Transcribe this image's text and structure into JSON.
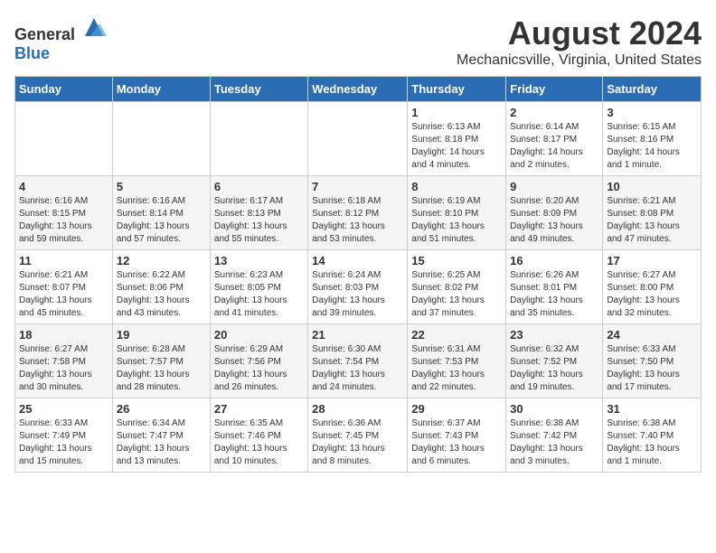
{
  "header": {
    "logo_general": "General",
    "logo_blue": "Blue",
    "title": "August 2024",
    "subtitle": "Mechanicsville, Virginia, United States"
  },
  "calendar": {
    "days_of_week": [
      "Sunday",
      "Monday",
      "Tuesday",
      "Wednesday",
      "Thursday",
      "Friday",
      "Saturday"
    ],
    "weeks": [
      [
        {
          "day": "",
          "info": ""
        },
        {
          "day": "",
          "info": ""
        },
        {
          "day": "",
          "info": ""
        },
        {
          "day": "",
          "info": ""
        },
        {
          "day": "1",
          "info": "Sunrise: 6:13 AM\nSunset: 8:18 PM\nDaylight: 14 hours\nand 4 minutes."
        },
        {
          "day": "2",
          "info": "Sunrise: 6:14 AM\nSunset: 8:17 PM\nDaylight: 14 hours\nand 2 minutes."
        },
        {
          "day": "3",
          "info": "Sunrise: 6:15 AM\nSunset: 8:16 PM\nDaylight: 14 hours\nand 1 minute."
        }
      ],
      [
        {
          "day": "4",
          "info": "Sunrise: 6:16 AM\nSunset: 8:15 PM\nDaylight: 13 hours\nand 59 minutes."
        },
        {
          "day": "5",
          "info": "Sunrise: 6:16 AM\nSunset: 8:14 PM\nDaylight: 13 hours\nand 57 minutes."
        },
        {
          "day": "6",
          "info": "Sunrise: 6:17 AM\nSunset: 8:13 PM\nDaylight: 13 hours\nand 55 minutes."
        },
        {
          "day": "7",
          "info": "Sunrise: 6:18 AM\nSunset: 8:12 PM\nDaylight: 13 hours\nand 53 minutes."
        },
        {
          "day": "8",
          "info": "Sunrise: 6:19 AM\nSunset: 8:10 PM\nDaylight: 13 hours\nand 51 minutes."
        },
        {
          "day": "9",
          "info": "Sunrise: 6:20 AM\nSunset: 8:09 PM\nDaylight: 13 hours\nand 49 minutes."
        },
        {
          "day": "10",
          "info": "Sunrise: 6:21 AM\nSunset: 8:08 PM\nDaylight: 13 hours\nand 47 minutes."
        }
      ],
      [
        {
          "day": "11",
          "info": "Sunrise: 6:21 AM\nSunset: 8:07 PM\nDaylight: 13 hours\nand 45 minutes."
        },
        {
          "day": "12",
          "info": "Sunrise: 6:22 AM\nSunset: 8:06 PM\nDaylight: 13 hours\nand 43 minutes."
        },
        {
          "day": "13",
          "info": "Sunrise: 6:23 AM\nSunset: 8:05 PM\nDaylight: 13 hours\nand 41 minutes."
        },
        {
          "day": "14",
          "info": "Sunrise: 6:24 AM\nSunset: 8:03 PM\nDaylight: 13 hours\nand 39 minutes."
        },
        {
          "day": "15",
          "info": "Sunrise: 6:25 AM\nSunset: 8:02 PM\nDaylight: 13 hours\nand 37 minutes."
        },
        {
          "day": "16",
          "info": "Sunrise: 6:26 AM\nSunset: 8:01 PM\nDaylight: 13 hours\nand 35 minutes."
        },
        {
          "day": "17",
          "info": "Sunrise: 6:27 AM\nSunset: 8:00 PM\nDaylight: 13 hours\nand 32 minutes."
        }
      ],
      [
        {
          "day": "18",
          "info": "Sunrise: 6:27 AM\nSunset: 7:58 PM\nDaylight: 13 hours\nand 30 minutes."
        },
        {
          "day": "19",
          "info": "Sunrise: 6:28 AM\nSunset: 7:57 PM\nDaylight: 13 hours\nand 28 minutes."
        },
        {
          "day": "20",
          "info": "Sunrise: 6:29 AM\nSunset: 7:56 PM\nDaylight: 13 hours\nand 26 minutes."
        },
        {
          "day": "21",
          "info": "Sunrise: 6:30 AM\nSunset: 7:54 PM\nDaylight: 13 hours\nand 24 minutes."
        },
        {
          "day": "22",
          "info": "Sunrise: 6:31 AM\nSunset: 7:53 PM\nDaylight: 13 hours\nand 22 minutes."
        },
        {
          "day": "23",
          "info": "Sunrise: 6:32 AM\nSunset: 7:52 PM\nDaylight: 13 hours\nand 19 minutes."
        },
        {
          "day": "24",
          "info": "Sunrise: 6:33 AM\nSunset: 7:50 PM\nDaylight: 13 hours\nand 17 minutes."
        }
      ],
      [
        {
          "day": "25",
          "info": "Sunrise: 6:33 AM\nSunset: 7:49 PM\nDaylight: 13 hours\nand 15 minutes."
        },
        {
          "day": "26",
          "info": "Sunrise: 6:34 AM\nSunset: 7:47 PM\nDaylight: 13 hours\nand 13 minutes."
        },
        {
          "day": "27",
          "info": "Sunrise: 6:35 AM\nSunset: 7:46 PM\nDaylight: 13 hours\nand 10 minutes."
        },
        {
          "day": "28",
          "info": "Sunrise: 6:36 AM\nSunset: 7:45 PM\nDaylight: 13 hours\nand 8 minutes."
        },
        {
          "day": "29",
          "info": "Sunrise: 6:37 AM\nSunset: 7:43 PM\nDaylight: 13 hours\nand 6 minutes."
        },
        {
          "day": "30",
          "info": "Sunrise: 6:38 AM\nSunset: 7:42 PM\nDaylight: 13 hours\nand 3 minutes."
        },
        {
          "day": "31",
          "info": "Sunrise: 6:38 AM\nSunset: 7:40 PM\nDaylight: 13 hours\nand 1 minute."
        }
      ]
    ]
  }
}
